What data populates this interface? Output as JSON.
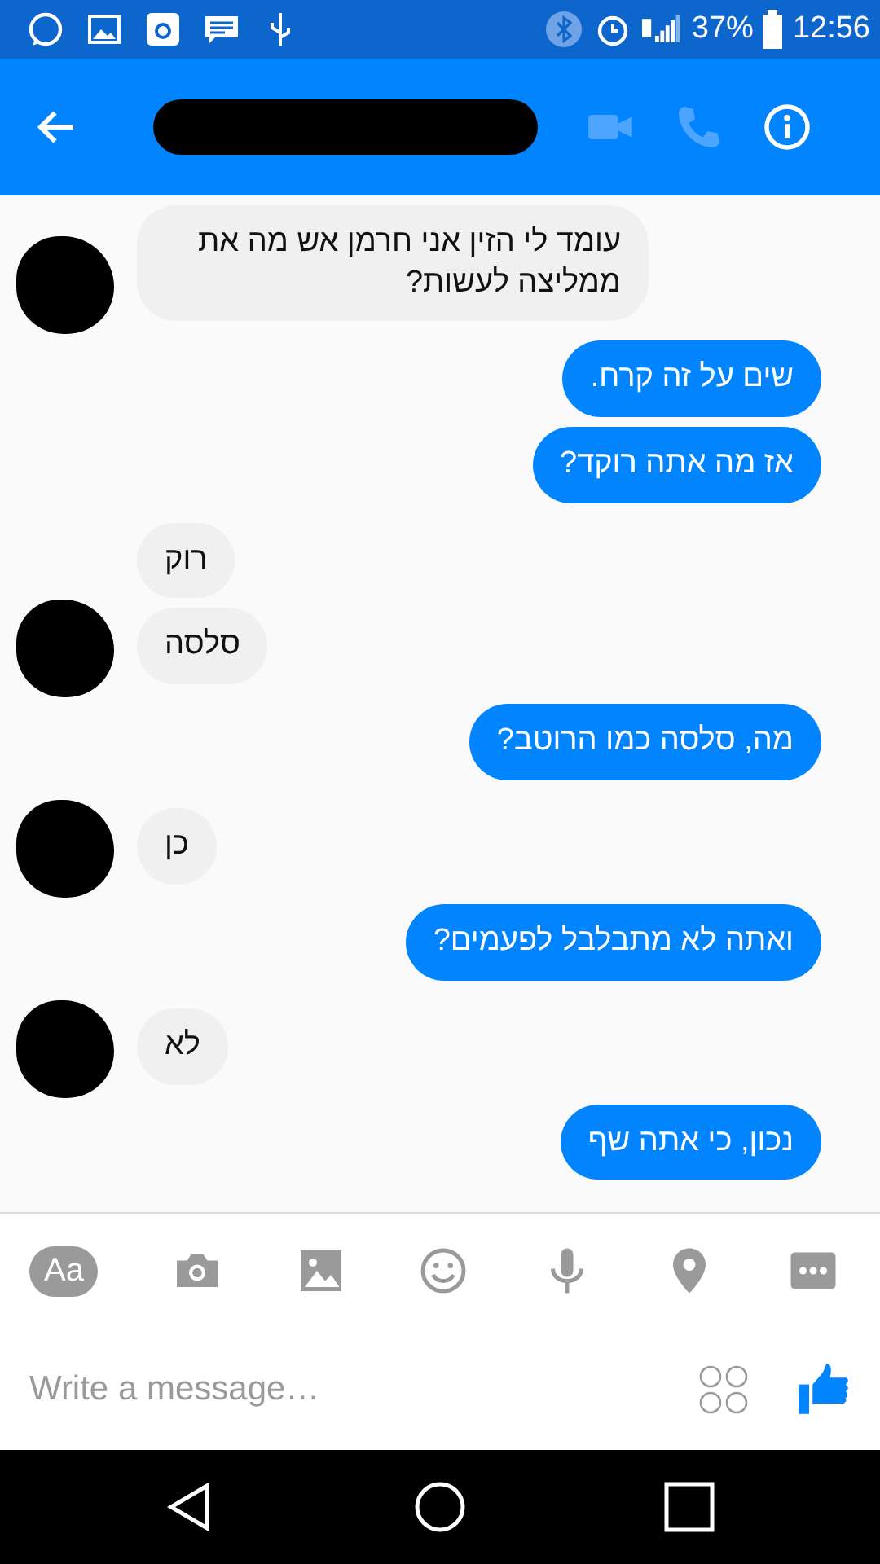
{
  "status_bar": {
    "battery": "37%",
    "time": "12:56"
  },
  "messages": [
    {
      "kind": "received",
      "texts": [
        "עומד לי הזין אני חרמן אש מה את ממליצה לעשות?"
      ]
    },
    {
      "kind": "sent",
      "texts": [
        "שים על זה קרח.",
        "אז מה אתה רוקד?"
      ]
    },
    {
      "kind": "received",
      "texts": [
        "רוק",
        "סלסה"
      ]
    },
    {
      "kind": "sent",
      "texts": [
        "מה, סלסה כמו הרוטב?"
      ]
    },
    {
      "kind": "received",
      "texts": [
        "כן"
      ]
    },
    {
      "kind": "sent",
      "texts": [
        "ואתה לא מתבלבל לפעמים?"
      ]
    },
    {
      "kind": "received",
      "texts": [
        "לא"
      ]
    },
    {
      "kind": "sent",
      "texts": [
        "נכון, כי אתה שף"
      ]
    }
  ],
  "toolbar": {
    "text_button": "Aa"
  },
  "composer": {
    "placeholder": "Write a message…"
  }
}
